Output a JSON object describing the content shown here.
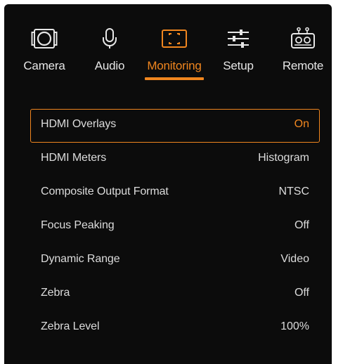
{
  "colors": {
    "background": "#0c0c0c",
    "accent": "#f0861f",
    "text": "#dcdcdc"
  },
  "tabs": [
    {
      "label": "Camera",
      "icon": "camera-icon",
      "active": false
    },
    {
      "label": "Audio",
      "icon": "microphone-icon",
      "active": false
    },
    {
      "label": "Monitoring",
      "icon": "monitoring-frame-icon",
      "active": true
    },
    {
      "label": "Setup",
      "icon": "sliders-icon",
      "active": false
    },
    {
      "label": "Remote",
      "icon": "remote-control-icon",
      "active": false
    }
  ],
  "settings": [
    {
      "label": "HDMI Overlays",
      "value": "On",
      "selected": true
    },
    {
      "label": "HDMI Meters",
      "value": "Histogram",
      "selected": false
    },
    {
      "label": "Composite Output Format",
      "value": "NTSC",
      "selected": false
    },
    {
      "label": "Focus Peaking",
      "value": "Off",
      "selected": false
    },
    {
      "label": "Dynamic Range",
      "value": "Video",
      "selected": false
    },
    {
      "label": "Zebra",
      "value": "Off",
      "selected": false
    },
    {
      "label": "Zebra Level",
      "value": "100%",
      "selected": false
    }
  ]
}
